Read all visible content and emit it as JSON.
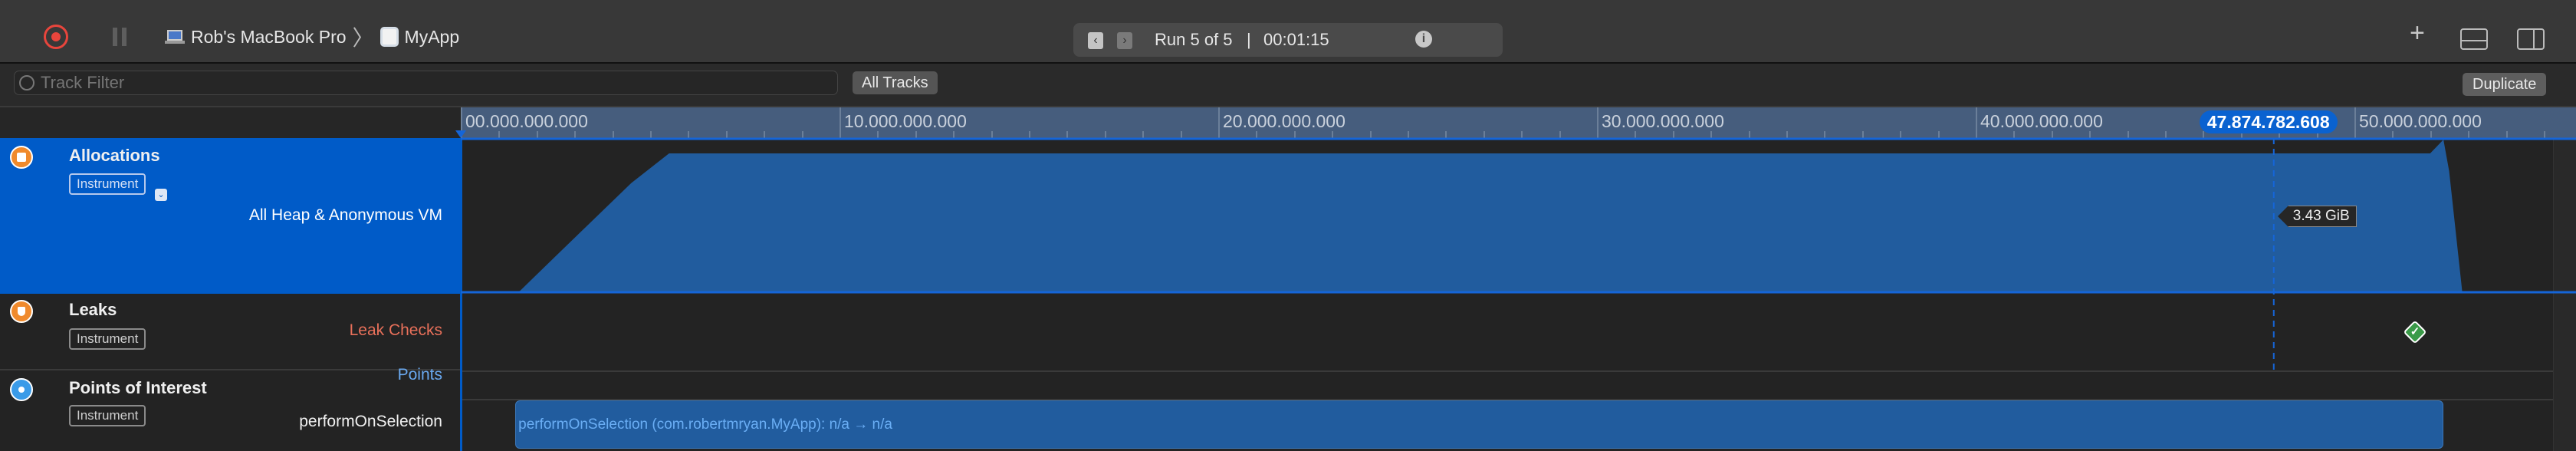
{
  "toolbar": {
    "device": "Rob's MacBook Pro",
    "app": "MyApp",
    "run_label": "Run 5 of 5",
    "separator": "|",
    "elapsed": "00:01:15",
    "icons": [
      "record-icon",
      "pause-icon",
      "laptop-icon",
      "chevron-right-icon",
      "app-icon",
      "chevron-left-icon",
      "chevron-right-icon",
      "info-icon",
      "plus-icon",
      "bottom-panel-icon",
      "inspector-panel-icon"
    ]
  },
  "filter": {
    "placeholder": "Track Filter",
    "all_tracks": "All Tracks",
    "duplicate": "Duplicate"
  },
  "ruler": {
    "ticks": [
      "00.000.000.000",
      "10.000.000.000",
      "20.000.000.000",
      "30.000.000.000",
      "40.000.000.000",
      "50.000.000.000"
    ],
    "cursor": "47.874.782.608"
  },
  "tracks": [
    {
      "title": "Allocations",
      "badge": "Instrument",
      "detail": "All Heap & Anonymous VM",
      "icon": "allocations-icon",
      "selected": true
    },
    {
      "title": "Leaks",
      "badge": "Instrument",
      "detail": "Leak Checks",
      "detail_color": "#e8705a",
      "icon": "leaks-icon"
    },
    {
      "title": "Points of Interest",
      "badge": "Instrument",
      "detail_top": "Points",
      "detail_top_color": "#6aa9f0",
      "detail": "performOnSelection",
      "icon": "points-of-interest-icon"
    }
  ],
  "colors": {
    "accent": "#005bc8",
    "graph": "#215c9e",
    "ruler": "#465d7d",
    "record": "#e8453c"
  },
  "chart_data": {
    "type": "area",
    "xunit": "seconds",
    "yunit": "GiB",
    "x": [
      0,
      1.2,
      1.56,
      2.5,
      3.5,
      4.5,
      5.5,
      52.0,
      52.35,
      52.5,
      52.85
    ],
    "y": [
      0,
      0.02,
      0.05,
      0.9,
      1.8,
      2.7,
      3.43,
      3.43,
      3.77,
      3.0,
      0
    ],
    "cursor_time": 47.87,
    "cursor_value": "3.43 GiB",
    "leak_check_time": 51.6,
    "poi_interval": {
      "start": 1.44,
      "end": 52.35,
      "label": "performOnSelection (com.robertmryan.MyApp): n/a → n/a"
    }
  }
}
